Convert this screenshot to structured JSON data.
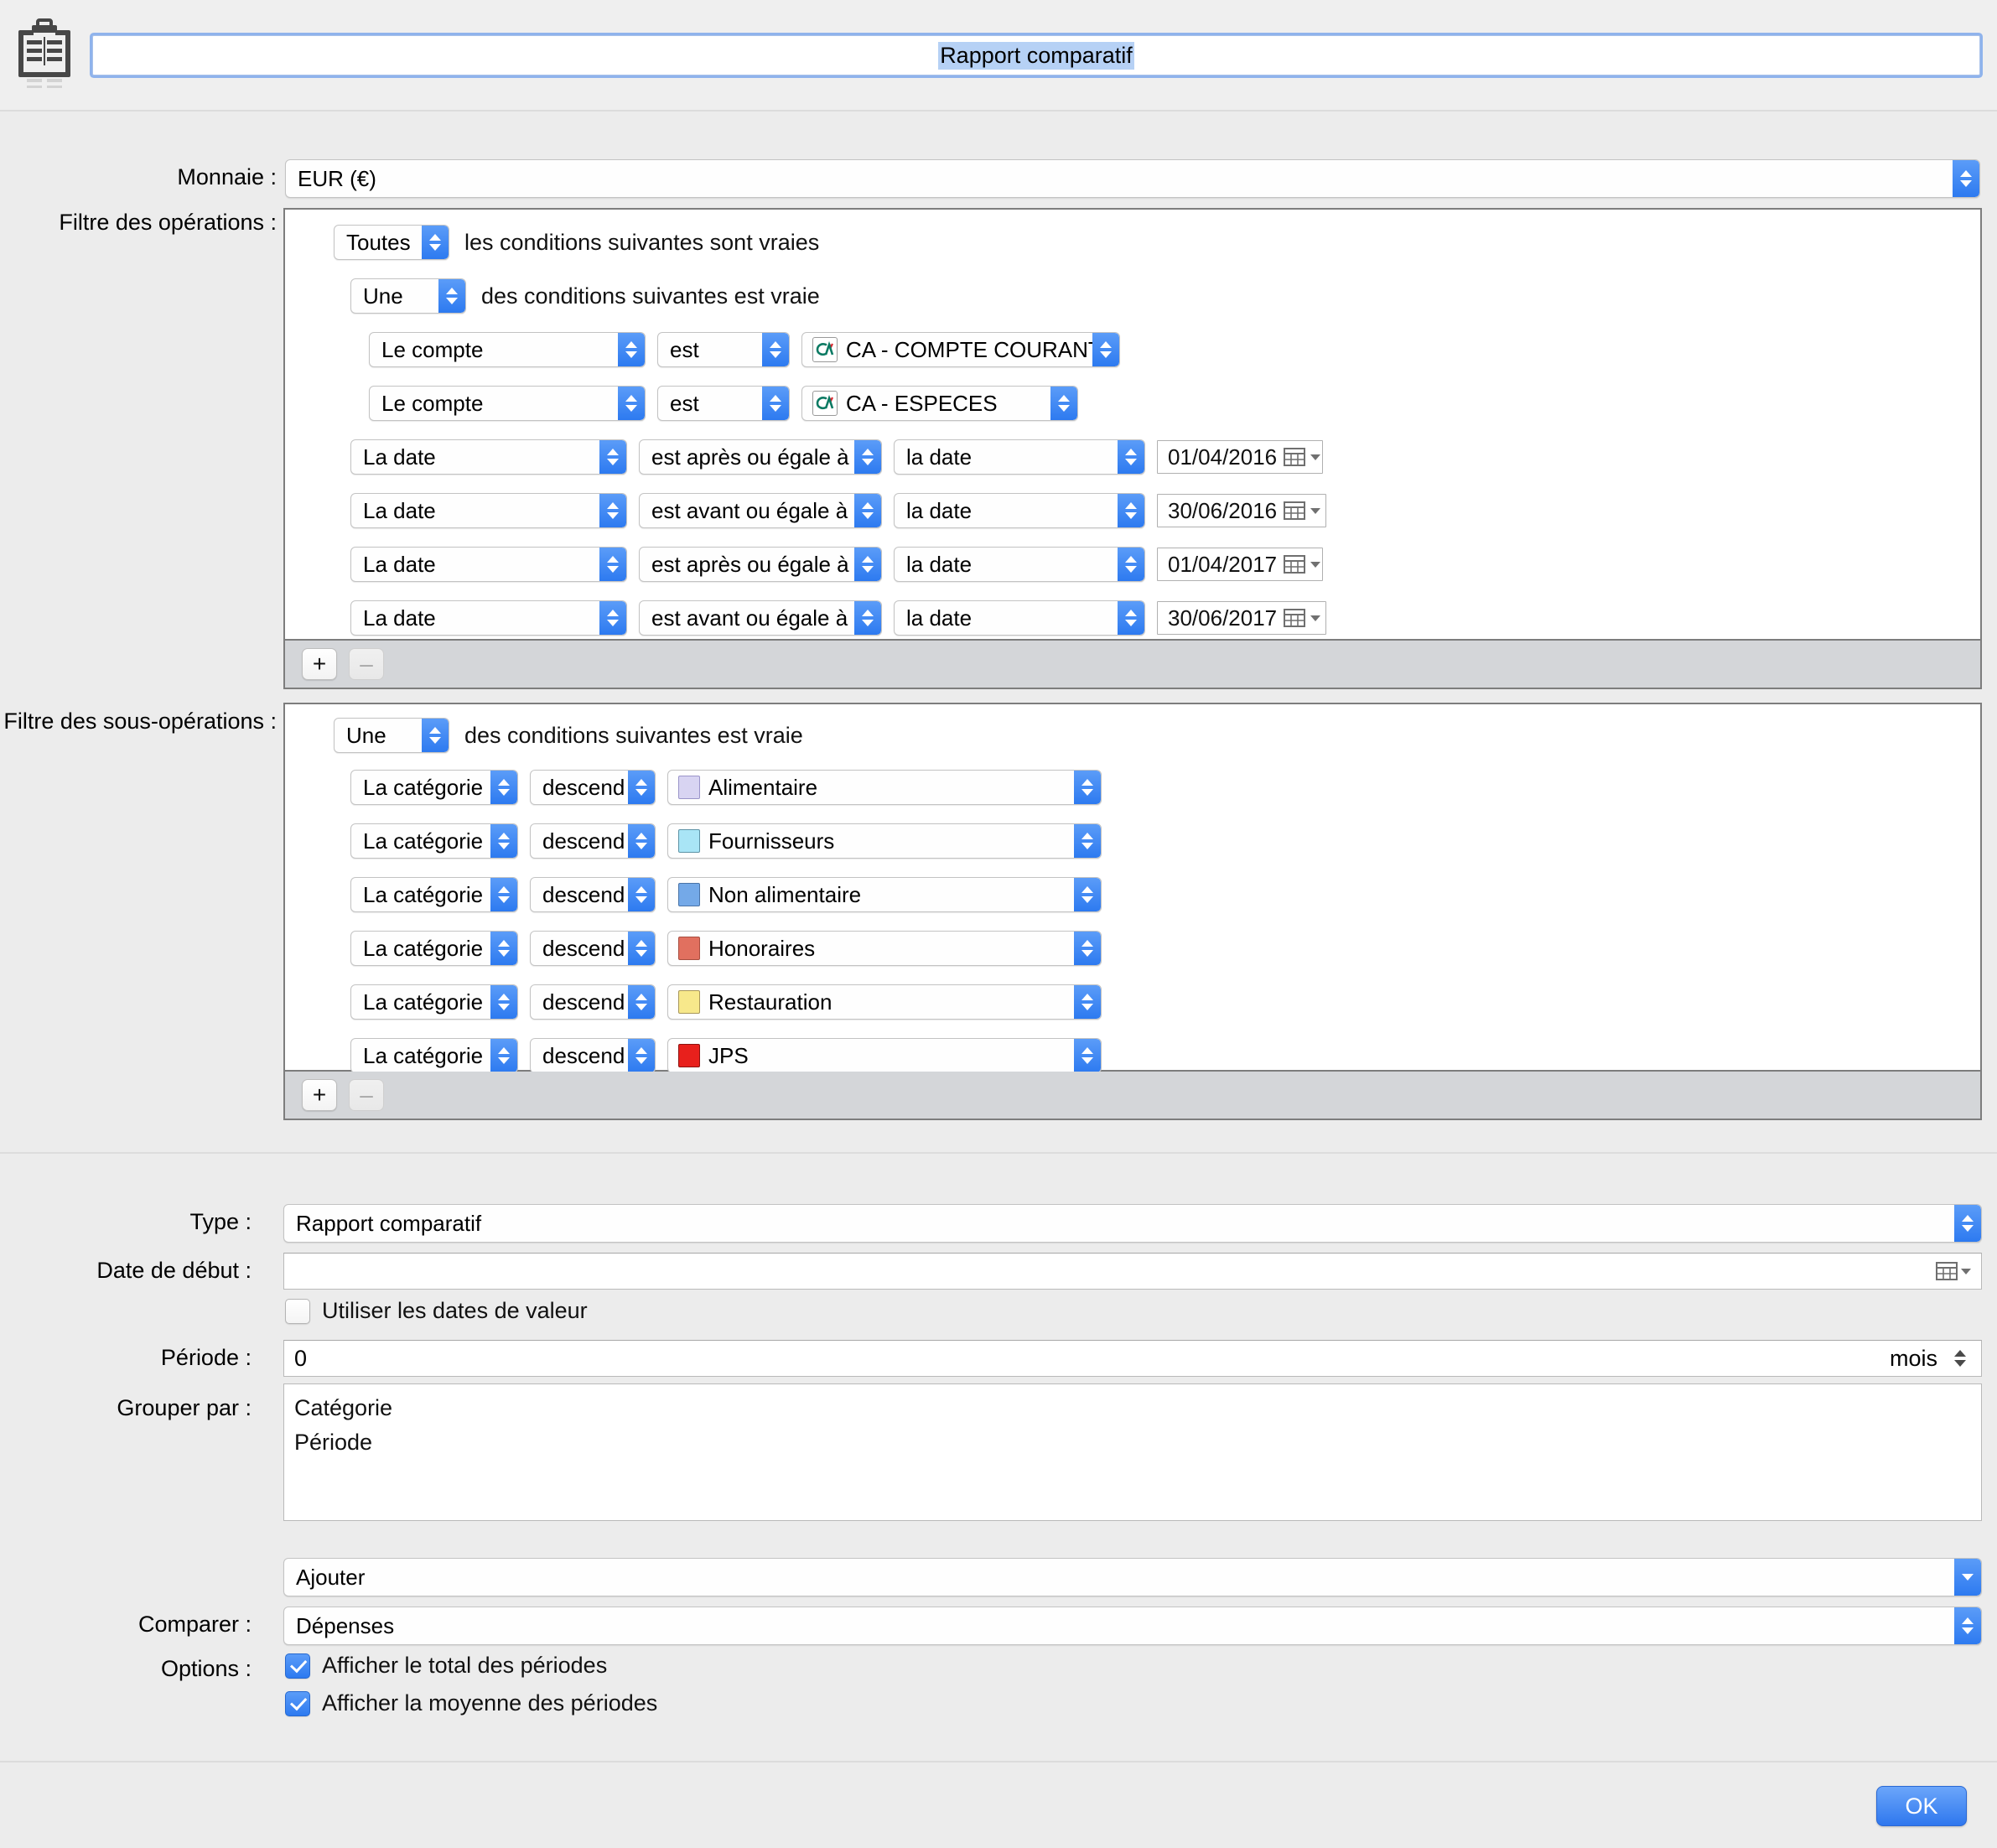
{
  "window": {
    "icon": "report-clipboard-icon",
    "title": "Rapport comparatif"
  },
  "currency": {
    "label": "Monnaie :",
    "value": "EUR (€)"
  },
  "operations_filter": {
    "label": "Filtre des opérations :",
    "root": {
      "quantifier": "Toutes",
      "phrase": "les conditions suivantes sont vraies"
    },
    "group": {
      "quantifier": "Une",
      "phrase": "des conditions suivantes est vraie"
    },
    "account_rows": [
      {
        "field": "Le compte",
        "operator": "est",
        "value": "CA - COMPTE COURANT",
        "icon": "credit-agricole-icon"
      },
      {
        "field": "Le compte",
        "operator": "est",
        "value": "CA - ESPECES",
        "icon": "credit-agricole-icon"
      }
    ],
    "date_rows": [
      {
        "field": "La date",
        "operator": "est après ou égale à",
        "mode": "la date",
        "date": "01/04/2016"
      },
      {
        "field": "La date",
        "operator": "est avant ou égale à",
        "mode": "la date",
        "date": "30/06/2016"
      },
      {
        "field": "La date",
        "operator": "est après ou égale à",
        "mode": "la date",
        "date": "01/04/2017"
      },
      {
        "field": "La date",
        "operator": "est avant ou égale à",
        "mode": "la date",
        "date": "30/06/2017"
      }
    ],
    "add_label": "+",
    "remove_label": "–"
  },
  "suboperations_filter": {
    "label": "Filtre des sous-opérations :",
    "group": {
      "quantifier": "Une",
      "phrase": "des conditions suivantes est vraie"
    },
    "rows": [
      {
        "field": "La catégorie",
        "operator": "descend de",
        "value": "Alimentaire",
        "color": "#d8d4f2"
      },
      {
        "field": "La catégorie",
        "operator": "descend de",
        "value": "Fournisseurs",
        "color": "#a9e5f6"
      },
      {
        "field": "La catégorie",
        "operator": "descend de",
        "value": "Non alimentaire",
        "color": "#74a9e8"
      },
      {
        "field": "La catégorie",
        "operator": "descend de",
        "value": "Honoraires",
        "color": "#e1705f"
      },
      {
        "field": "La catégorie",
        "operator": "descend de",
        "value": "Restauration",
        "color": "#f7e88b"
      },
      {
        "field": "La catégorie",
        "operator": "descend de",
        "value": "JPS",
        "color": "#e8201c"
      }
    ],
    "add_label": "+",
    "remove_label": "–"
  },
  "report": {
    "type": {
      "label": "Type :",
      "value": "Rapport comparatif"
    },
    "start_date": {
      "label": "Date de début :",
      "value": ""
    },
    "use_value_dates": {
      "label": "Utiliser les dates de valeur",
      "checked": false
    },
    "period": {
      "label": "Période :",
      "value": "0",
      "unit": "mois"
    },
    "group_by": {
      "label": "Grouper par :",
      "items": [
        "Catégorie",
        "Période"
      ],
      "add_label": "Ajouter"
    },
    "compare": {
      "label": "Comparer :",
      "value": "Dépenses"
    },
    "options": {
      "label": "Options :",
      "items": [
        {
          "label": "Afficher le total des périodes",
          "checked": true
        },
        {
          "label": "Afficher la moyenne des périodes",
          "checked": true
        }
      ]
    }
  },
  "footer": {
    "ok_label": "OK"
  },
  "colors": {
    "accent": "#2d7af0",
    "window_bg": "#ececec",
    "panel_footer_bg": "#d4d6d9"
  }
}
